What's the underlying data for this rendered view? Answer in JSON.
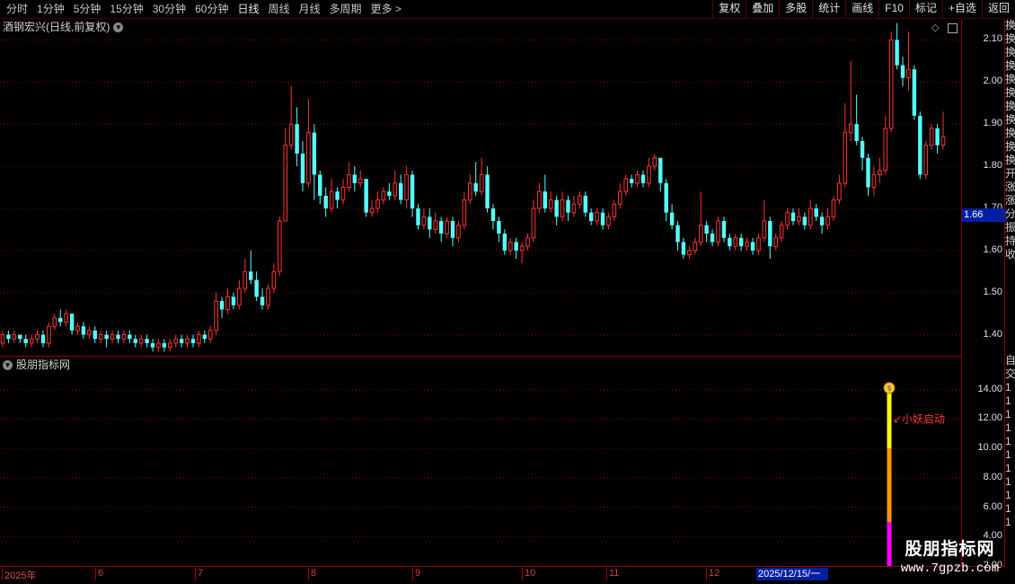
{
  "toolbar": {
    "periods": [
      "分时",
      "1分钟",
      "5分钟",
      "15分钟",
      "30分钟",
      "60分钟",
      "日线",
      "周线",
      "月线",
      "多周期",
      "更多 >"
    ],
    "active_period": "日线",
    "buttons": [
      "复权",
      "叠加",
      "多股",
      "统计",
      "画线",
      "F10",
      "标记",
      "+自选",
      "返回"
    ]
  },
  "price_panel": {
    "title": "酒钢宏兴(日线,前复权)",
    "y_ticks": [
      "2.10",
      "2.00",
      "1.90",
      "1.80",
      "1.70",
      "1.60",
      "1.50",
      "1.40"
    ],
    "last_price": "1.66"
  },
  "indicator_panel": {
    "title": "股朋指标网",
    "y_ticks": [
      "14.00",
      "12.00",
      "10.00",
      "8.00",
      "6.00",
      "4.00",
      "2.00"
    ],
    "annotation": "小妖启动"
  },
  "date_axis": {
    "labels": [
      "2025年",
      "6",
      "7",
      "8",
      "9",
      "10",
      "11",
      "12"
    ],
    "highlight": "2025/12/15/一"
  },
  "side_strip": {
    "glyphs": [
      "换",
      "换",
      "换",
      "换",
      "换",
      "换",
      "换",
      "换",
      "换",
      "换",
      "换",
      "开",
      "涨",
      "涨",
      "分",
      "振",
      "持",
      "收"
    ],
    "lower_glyphs": [
      "自",
      "交",
      "1",
      "1",
      "1",
      "1",
      "1",
      "1",
      "1",
      "1",
      "1",
      "1",
      "1"
    ]
  },
  "watermark": {
    "title": "股朋指标网",
    "url": "www.7gpzb.com"
  },
  "colors": {
    "up": "#ff3232",
    "down": "#54ffff",
    "grid": "#8a0000",
    "signal_yellow": "#ffff00",
    "signal_orange": "#ff9900",
    "signal_magenta": "#ff00ff"
  },
  "chart_data": {
    "type": "candlestick",
    "y_axis": [
      1.35,
      2.15
    ],
    "series": [
      {
        "o": 1.38,
        "c": 1.4,
        "h": 1.41,
        "l": 1.37
      },
      {
        "o": 1.4,
        "c": 1.39,
        "h": 1.41,
        "l": 1.38
      },
      {
        "o": 1.39,
        "c": 1.4,
        "h": 1.41,
        "l": 1.38
      },
      {
        "o": 1.4,
        "c": 1.39,
        "h": 1.4,
        "l": 1.38
      },
      {
        "o": 1.39,
        "c": 1.38,
        "h": 1.4,
        "l": 1.37
      },
      {
        "o": 1.38,
        "c": 1.39,
        "h": 1.4,
        "l": 1.37
      },
      {
        "o": 1.39,
        "c": 1.4,
        "h": 1.41,
        "l": 1.38
      },
      {
        "o": 1.4,
        "c": 1.38,
        "h": 1.41,
        "l": 1.37
      },
      {
        "o": 1.38,
        "c": 1.42,
        "h": 1.43,
        "l": 1.37
      },
      {
        "o": 1.42,
        "c": 1.44,
        "h": 1.45,
        "l": 1.41
      },
      {
        "o": 1.44,
        "c": 1.43,
        "h": 1.46,
        "l": 1.42
      },
      {
        "o": 1.43,
        "c": 1.45,
        "h": 1.46,
        "l": 1.42
      },
      {
        "o": 1.45,
        "c": 1.41,
        "h": 1.45,
        "l": 1.4
      },
      {
        "o": 1.41,
        "c": 1.42,
        "h": 1.43,
        "l": 1.4
      },
      {
        "o": 1.42,
        "c": 1.4,
        "h": 1.43,
        "l": 1.39
      },
      {
        "o": 1.4,
        "c": 1.41,
        "h": 1.42,
        "l": 1.39
      },
      {
        "o": 1.41,
        "c": 1.39,
        "h": 1.42,
        "l": 1.38
      },
      {
        "o": 1.39,
        "c": 1.4,
        "h": 1.41,
        "l": 1.38
      },
      {
        "o": 1.4,
        "c": 1.39,
        "h": 1.41,
        "l": 1.37
      },
      {
        "o": 1.39,
        "c": 1.4,
        "h": 1.41,
        "l": 1.38
      },
      {
        "o": 1.4,
        "c": 1.39,
        "h": 1.41,
        "l": 1.38
      },
      {
        "o": 1.39,
        "c": 1.4,
        "h": 1.41,
        "l": 1.38
      },
      {
        "o": 1.4,
        "c": 1.39,
        "h": 1.41,
        "l": 1.38
      },
      {
        "o": 1.39,
        "c": 1.38,
        "h": 1.4,
        "l": 1.37
      },
      {
        "o": 1.38,
        "c": 1.39,
        "h": 1.4,
        "l": 1.37
      },
      {
        "o": 1.39,
        "c": 1.38,
        "h": 1.4,
        "l": 1.37
      },
      {
        "o": 1.38,
        "c": 1.37,
        "h": 1.39,
        "l": 1.36
      },
      {
        "o": 1.37,
        "c": 1.38,
        "h": 1.39,
        "l": 1.36
      },
      {
        "o": 1.38,
        "c": 1.37,
        "h": 1.39,
        "l": 1.36
      },
      {
        "o": 1.37,
        "c": 1.38,
        "h": 1.39,
        "l": 1.36
      },
      {
        "o": 1.38,
        "c": 1.39,
        "h": 1.4,
        "l": 1.37
      },
      {
        "o": 1.39,
        "c": 1.38,
        "h": 1.4,
        "l": 1.37
      },
      {
        "o": 1.38,
        "c": 1.39,
        "h": 1.4,
        "l": 1.37
      },
      {
        "o": 1.39,
        "c": 1.38,
        "h": 1.4,
        "l": 1.37
      },
      {
        "o": 1.38,
        "c": 1.4,
        "h": 1.41,
        "l": 1.37
      },
      {
        "o": 1.4,
        "c": 1.39,
        "h": 1.41,
        "l": 1.38
      },
      {
        "o": 1.39,
        "c": 1.41,
        "h": 1.42,
        "l": 1.38
      },
      {
        "o": 1.41,
        "c": 1.48,
        "h": 1.5,
        "l": 1.4
      },
      {
        "o": 1.48,
        "c": 1.46,
        "h": 1.49,
        "l": 1.44
      },
      {
        "o": 1.46,
        "c": 1.49,
        "h": 1.51,
        "l": 1.45
      },
      {
        "o": 1.49,
        "c": 1.47,
        "h": 1.5,
        "l": 1.46
      },
      {
        "o": 1.47,
        "c": 1.51,
        "h": 1.53,
        "l": 1.46
      },
      {
        "o": 1.51,
        "c": 1.55,
        "h": 1.58,
        "l": 1.5
      },
      {
        "o": 1.55,
        "c": 1.53,
        "h": 1.6,
        "l": 1.52
      },
      {
        "o": 1.53,
        "c": 1.49,
        "h": 1.55,
        "l": 1.48
      },
      {
        "o": 1.49,
        "c": 1.47,
        "h": 1.51,
        "l": 1.46
      },
      {
        "o": 1.47,
        "c": 1.51,
        "h": 1.52,
        "l": 1.46
      },
      {
        "o": 1.51,
        "c": 1.55,
        "h": 1.57,
        "l": 1.5
      },
      {
        "o": 1.55,
        "c": 1.67,
        "h": 1.68,
        "l": 1.54
      },
      {
        "o": 1.67,
        "c": 1.85,
        "h": 1.89,
        "l": 1.67
      },
      {
        "o": 1.85,
        "c": 1.9,
        "h": 1.99,
        "l": 1.84
      },
      {
        "o": 1.9,
        "c": 1.83,
        "h": 1.94,
        "l": 1.8
      },
      {
        "o": 1.83,
        "c": 1.76,
        "h": 1.86,
        "l": 1.74
      },
      {
        "o": 1.76,
        "c": 1.88,
        "h": 1.96,
        "l": 1.75
      },
      {
        "o": 1.88,
        "c": 1.78,
        "h": 1.9,
        "l": 1.72
      },
      {
        "o": 1.78,
        "c": 1.73,
        "h": 1.79,
        "l": 1.71
      },
      {
        "o": 1.73,
        "c": 1.7,
        "h": 1.75,
        "l": 1.68
      },
      {
        "o": 1.7,
        "c": 1.74,
        "h": 1.77,
        "l": 1.69
      },
      {
        "o": 1.74,
        "c": 1.72,
        "h": 1.75,
        "l": 1.7
      },
      {
        "o": 1.72,
        "c": 1.75,
        "h": 1.77,
        "l": 1.71
      },
      {
        "o": 1.75,
        "c": 1.78,
        "h": 1.81,
        "l": 1.74
      },
      {
        "o": 1.78,
        "c": 1.76,
        "h": 1.8,
        "l": 1.74
      },
      {
        "o": 1.76,
        "c": 1.77,
        "h": 1.79,
        "l": 1.75
      },
      {
        "o": 1.77,
        "c": 1.69,
        "h": 1.77,
        "l": 1.68
      },
      {
        "o": 1.69,
        "c": 1.7,
        "h": 1.72,
        "l": 1.68
      },
      {
        "o": 1.7,
        "c": 1.72,
        "h": 1.74,
        "l": 1.69
      },
      {
        "o": 1.72,
        "c": 1.74,
        "h": 1.75,
        "l": 1.71
      },
      {
        "o": 1.74,
        "c": 1.73,
        "h": 1.76,
        "l": 1.72
      },
      {
        "o": 1.73,
        "c": 1.76,
        "h": 1.79,
        "l": 1.72
      },
      {
        "o": 1.76,
        "c": 1.72,
        "h": 1.78,
        "l": 1.71
      },
      {
        "o": 1.72,
        "c": 1.78,
        "h": 1.8,
        "l": 1.7
      },
      {
        "o": 1.78,
        "c": 1.7,
        "h": 1.79,
        "l": 1.68
      },
      {
        "o": 1.7,
        "c": 1.66,
        "h": 1.71,
        "l": 1.65
      },
      {
        "o": 1.66,
        "c": 1.68,
        "h": 1.7,
        "l": 1.65
      },
      {
        "o": 1.68,
        "c": 1.65,
        "h": 1.7,
        "l": 1.63
      },
      {
        "o": 1.65,
        "c": 1.67,
        "h": 1.69,
        "l": 1.64
      },
      {
        "o": 1.67,
        "c": 1.64,
        "h": 1.68,
        "l": 1.62
      },
      {
        "o": 1.64,
        "c": 1.67,
        "h": 1.68,
        "l": 1.63
      },
      {
        "o": 1.67,
        "c": 1.63,
        "h": 1.68,
        "l": 1.61
      },
      {
        "o": 1.63,
        "c": 1.66,
        "h": 1.67,
        "l": 1.62
      },
      {
        "o": 1.66,
        "c": 1.72,
        "h": 1.74,
        "l": 1.65
      },
      {
        "o": 1.72,
        "c": 1.76,
        "h": 1.78,
        "l": 1.71
      },
      {
        "o": 1.76,
        "c": 1.74,
        "h": 1.81,
        "l": 1.73
      },
      {
        "o": 1.74,
        "c": 1.78,
        "h": 1.82,
        "l": 1.73
      },
      {
        "o": 1.78,
        "c": 1.7,
        "h": 1.8,
        "l": 1.69
      },
      {
        "o": 1.7,
        "c": 1.67,
        "h": 1.71,
        "l": 1.65
      },
      {
        "o": 1.67,
        "c": 1.64,
        "h": 1.68,
        "l": 1.62
      },
      {
        "o": 1.64,
        "c": 1.6,
        "h": 1.65,
        "l": 1.59
      },
      {
        "o": 1.6,
        "c": 1.62,
        "h": 1.63,
        "l": 1.59
      },
      {
        "o": 1.62,
        "c": 1.6,
        "h": 1.63,
        "l": 1.58
      },
      {
        "o": 1.6,
        "c": 1.61,
        "h": 1.62,
        "l": 1.57
      },
      {
        "o": 1.61,
        "c": 1.63,
        "h": 1.64,
        "l": 1.6
      },
      {
        "o": 1.63,
        "c": 1.7,
        "h": 1.72,
        "l": 1.62
      },
      {
        "o": 1.7,
        "c": 1.74,
        "h": 1.76,
        "l": 1.69
      },
      {
        "o": 1.74,
        "c": 1.7,
        "h": 1.78,
        "l": 1.69
      },
      {
        "o": 1.7,
        "c": 1.72,
        "h": 1.74,
        "l": 1.69
      },
      {
        "o": 1.72,
        "c": 1.68,
        "h": 1.73,
        "l": 1.66
      },
      {
        "o": 1.68,
        "c": 1.72,
        "h": 1.74,
        "l": 1.67
      },
      {
        "o": 1.72,
        "c": 1.69,
        "h": 1.73,
        "l": 1.67
      },
      {
        "o": 1.69,
        "c": 1.71,
        "h": 1.73,
        "l": 1.68
      },
      {
        "o": 1.71,
        "c": 1.73,
        "h": 1.74,
        "l": 1.7
      },
      {
        "o": 1.73,
        "c": 1.69,
        "h": 1.74,
        "l": 1.68
      },
      {
        "o": 1.69,
        "c": 1.67,
        "h": 1.7,
        "l": 1.66
      },
      {
        "o": 1.67,
        "c": 1.69,
        "h": 1.7,
        "l": 1.66
      },
      {
        "o": 1.69,
        "c": 1.66,
        "h": 1.7,
        "l": 1.65
      },
      {
        "o": 1.66,
        "c": 1.68,
        "h": 1.69,
        "l": 1.65
      },
      {
        "o": 1.68,
        "c": 1.71,
        "h": 1.72,
        "l": 1.67
      },
      {
        "o": 1.71,
        "c": 1.74,
        "h": 1.76,
        "l": 1.7
      },
      {
        "o": 1.74,
        "c": 1.77,
        "h": 1.78,
        "l": 1.73
      },
      {
        "o": 1.77,
        "c": 1.76,
        "h": 1.78,
        "l": 1.75
      },
      {
        "o": 1.76,
        "c": 1.78,
        "h": 1.79,
        "l": 1.75
      },
      {
        "o": 1.78,
        "c": 1.76,
        "h": 1.79,
        "l": 1.75
      },
      {
        "o": 1.76,
        "c": 1.8,
        "h": 1.82,
        "l": 1.75
      },
      {
        "o": 1.8,
        "c": 1.82,
        "h": 1.83,
        "l": 1.79
      },
      {
        "o": 1.82,
        "c": 1.76,
        "h": 1.82,
        "l": 1.74
      },
      {
        "o": 1.76,
        "c": 1.69,
        "h": 1.77,
        "l": 1.67
      },
      {
        "o": 1.69,
        "c": 1.66,
        "h": 1.71,
        "l": 1.65
      },
      {
        "o": 1.66,
        "c": 1.62,
        "h": 1.67,
        "l": 1.6
      },
      {
        "o": 1.62,
        "c": 1.59,
        "h": 1.63,
        "l": 1.58
      },
      {
        "o": 1.59,
        "c": 1.6,
        "h": 1.61,
        "l": 1.58
      },
      {
        "o": 1.6,
        "c": 1.62,
        "h": 1.63,
        "l": 1.59
      },
      {
        "o": 1.62,
        "c": 1.66,
        "h": 1.74,
        "l": 1.61
      },
      {
        "o": 1.66,
        "c": 1.64,
        "h": 1.67,
        "l": 1.62
      },
      {
        "o": 1.64,
        "c": 1.62,
        "h": 1.65,
        "l": 1.61
      },
      {
        "o": 1.62,
        "c": 1.67,
        "h": 1.68,
        "l": 1.61
      },
      {
        "o": 1.67,
        "c": 1.63,
        "h": 1.68,
        "l": 1.62
      },
      {
        "o": 1.63,
        "c": 1.61,
        "h": 1.64,
        "l": 1.6
      },
      {
        "o": 1.61,
        "c": 1.63,
        "h": 1.64,
        "l": 1.6
      },
      {
        "o": 1.63,
        "c": 1.61,
        "h": 1.64,
        "l": 1.6
      },
      {
        "o": 1.61,
        "c": 1.62,
        "h": 1.63,
        "l": 1.6
      },
      {
        "o": 1.62,
        "c": 1.6,
        "h": 1.63,
        "l": 1.59
      },
      {
        "o": 1.6,
        "c": 1.63,
        "h": 1.64,
        "l": 1.59
      },
      {
        "o": 1.63,
        "c": 1.67,
        "h": 1.72,
        "l": 1.62
      },
      {
        "o": 1.67,
        "c": 1.61,
        "h": 1.68,
        "l": 1.58
      },
      {
        "o": 1.61,
        "c": 1.63,
        "h": 1.64,
        "l": 1.6
      },
      {
        "o": 1.63,
        "c": 1.66,
        "h": 1.67,
        "l": 1.62
      },
      {
        "o": 1.66,
        "c": 1.69,
        "h": 1.7,
        "l": 1.65
      },
      {
        "o": 1.69,
        "c": 1.67,
        "h": 1.7,
        "l": 1.66
      },
      {
        "o": 1.67,
        "c": 1.68,
        "h": 1.7,
        "l": 1.66
      },
      {
        "o": 1.68,
        "c": 1.66,
        "h": 1.69,
        "l": 1.65
      },
      {
        "o": 1.66,
        "c": 1.7,
        "h": 1.72,
        "l": 1.65
      },
      {
        "o": 1.7,
        "c": 1.68,
        "h": 1.71,
        "l": 1.67
      },
      {
        "o": 1.68,
        "c": 1.66,
        "h": 1.69,
        "l": 1.64
      },
      {
        "o": 1.66,
        "c": 1.68,
        "h": 1.7,
        "l": 1.65
      },
      {
        "o": 1.68,
        "c": 1.72,
        "h": 1.73,
        "l": 1.67
      },
      {
        "o": 1.72,
        "c": 1.76,
        "h": 1.78,
        "l": 1.71
      },
      {
        "o": 1.76,
        "c": 1.88,
        "h": 1.95,
        "l": 1.75
      },
      {
        "o": 1.88,
        "c": 1.9,
        "h": 2.05,
        "l": 1.86
      },
      {
        "o": 1.9,
        "c": 1.86,
        "h": 1.97,
        "l": 1.85
      },
      {
        "o": 1.86,
        "c": 1.82,
        "h": 1.87,
        "l": 1.79
      },
      {
        "o": 1.82,
        "c": 1.75,
        "h": 1.83,
        "l": 1.73
      },
      {
        "o": 1.75,
        "c": 1.78,
        "h": 1.8,
        "l": 1.73
      },
      {
        "o": 1.78,
        "c": 1.79,
        "h": 1.82,
        "l": 1.76
      },
      {
        "o": 1.79,
        "c": 1.89,
        "h": 1.92,
        "l": 1.78
      },
      {
        "o": 1.89,
        "c": 2.1,
        "h": 2.12,
        "l": 1.88
      },
      {
        "o": 2.1,
        "c": 2.04,
        "h": 2.14,
        "l": 2.03
      },
      {
        "o": 2.04,
        "c": 2.01,
        "h": 2.06,
        "l": 1.99
      },
      {
        "o": 2.01,
        "c": 2.03,
        "h": 2.12,
        "l": 1.98
      },
      {
        "o": 2.03,
        "c": 1.92,
        "h": 2.04,
        "l": 1.91
      },
      {
        "o": 1.92,
        "c": 1.78,
        "h": 1.93,
        "l": 1.77
      },
      {
        "o": 1.78,
        "c": 1.85,
        "h": 1.86,
        "l": 1.77
      },
      {
        "o": 1.85,
        "c": 1.89,
        "h": 1.9,
        "l": 1.84
      },
      {
        "o": 1.89,
        "c": 1.85,
        "h": 1.9,
        "l": 1.83
      },
      {
        "o": 1.85,
        "c": 1.87,
        "h": 1.93,
        "l": 1.84
      }
    ],
    "signal_bar": {
      "bottom": 2.0,
      "magenta_top": 5.0,
      "orange_top": 10.0,
      "yellow_top": 14.0
    },
    "indicator_y_axis": [
      2.0,
      16.0
    ]
  }
}
